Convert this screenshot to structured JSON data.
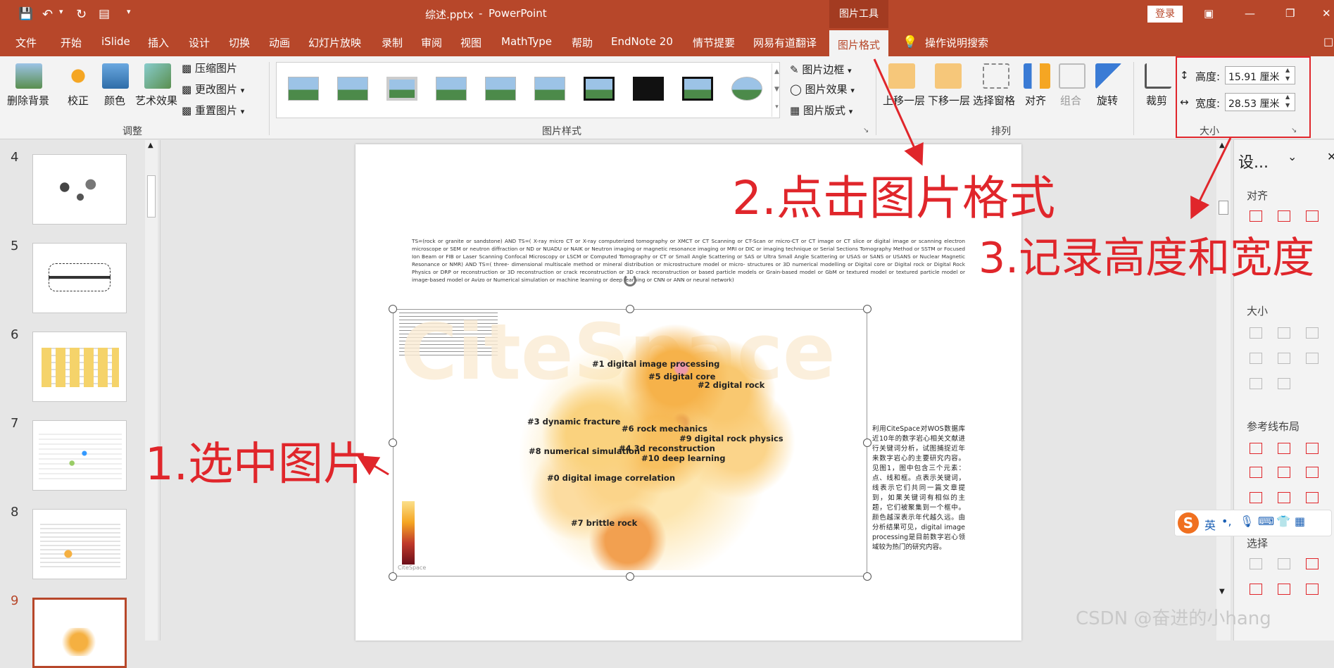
{
  "titlebar": {
    "filename": "综述.pptx",
    "sep": "-",
    "app": "PowerPoint",
    "context_tool": "图片工具",
    "login": "登录"
  },
  "tabs": [
    "文件",
    "开始",
    "iSlide",
    "插入",
    "设计",
    "切换",
    "动画",
    "幻灯片放映",
    "录制",
    "审阅",
    "视图",
    "MathType",
    "帮助",
    "EndNote 20",
    "情节提要",
    "网易有道翻译",
    "图片格式"
  ],
  "tell_me": "操作说明搜索",
  "ribbon": {
    "remove_bg": "删除背景",
    "correct": "校正",
    "color": "颜色",
    "art_effect": "艺术效果",
    "compress": "压缩图片",
    "change": "更改图片",
    "reset": "重置图片",
    "group_adjust": "调整",
    "group_styles": "图片样式",
    "border": "图片边框",
    "effect": "图片效果",
    "layout": "图片版式",
    "bring_forward": "上移一层",
    "send_backward": "下移一层",
    "selection_pane": "选择窗格",
    "align": "对齐",
    "group": "组合",
    "rotate": "旋转",
    "group_arrange": "排列",
    "crop": "裁剪",
    "height_label": "高度:",
    "height_value": "15.91 厘米",
    "width_label": "宽度:",
    "width_value": "28.53 厘米",
    "group_size": "大小"
  },
  "thumbnails": [
    {
      "num": "4"
    },
    {
      "num": "5"
    },
    {
      "num": "6"
    },
    {
      "num": "7"
    },
    {
      "num": "8"
    },
    {
      "num": "9"
    }
  ],
  "slide": {
    "query_text": "TS=(rock or granite or sandstone) AND TS=( X-ray micro CT or X-ray computerized tomography or XMCT or CT Scanning or CT-Scan or micro-CT or CT image or CT slice or digital image or scanning electron microscope or SEM or neutron diffraction or ND or NUADU or NAIK or Neutron imaging or magnetic resonance imaging or MRI or DIC or imaging technique or Serial Sections Tomography Method or SSTM or Focused Ion Beam or FIB or Laser Scanning Confocal Microscopy or LSCM or Computed Tomography or CT or Small Angle Scattering or SAS or Ultra Small Angle Scattering or USAS or SANS or USANS or Nuclear Magnetic Resonance or NMR) AND TS=( three- dimensional multiscale method or mineral distribution or microstructure model or micro- structures or 3D numerical modelling or Digital core or Digital rock or Digital Rock Physics or DRP or reconstruction or 3D reconstruction or crack reconstruction or 3D crack reconstruction or based particle models or Grain-based model or GbM or textured model or textured particle model or image-based model or Avizo or Numerical simulation or machine learning or deep learning or CNN or ANN or neural network)",
    "clusters": [
      "#1 digital image processing",
      "#5 digital core",
      "#2 digital rock",
      "#3 dynamic fracture",
      "#6 rock mechanics",
      "#9 digital rock physics",
      "#4 3d reconstruction",
      "#8 numerical simulation",
      "#10 deep learning",
      "#0 digital image correlation",
      "#7 brittle rock"
    ],
    "watermark": "CiteSpace",
    "side_text": "利用CiteSpace对WOS数据库近10年的数字岩心相关文献进行关键词分析，试图捕捉近年来数字岩心的主要研究内容。见图1，图中包含三个元素：点、线和框。点表示关键词，线表示它们共同一篇文章提到，如果关键词有相似的主题，它们被聚集到一个框中。颜色越深表示年代越久远。由分析结果可见，digital image processing是目前数字岩心领域较为热门的研究内容。"
  },
  "annotations": {
    "a1": "1.选中图片",
    "a2": "2.点击图片格式",
    "a3": "3.记录高度和宽度"
  },
  "rightpane": {
    "title": "设...",
    "align": "对齐",
    "size": "大小",
    "guides": "参考线布局",
    "select": "选择"
  },
  "ime": {
    "lang": "英"
  },
  "footer": "CSDN @奋进的小hang"
}
